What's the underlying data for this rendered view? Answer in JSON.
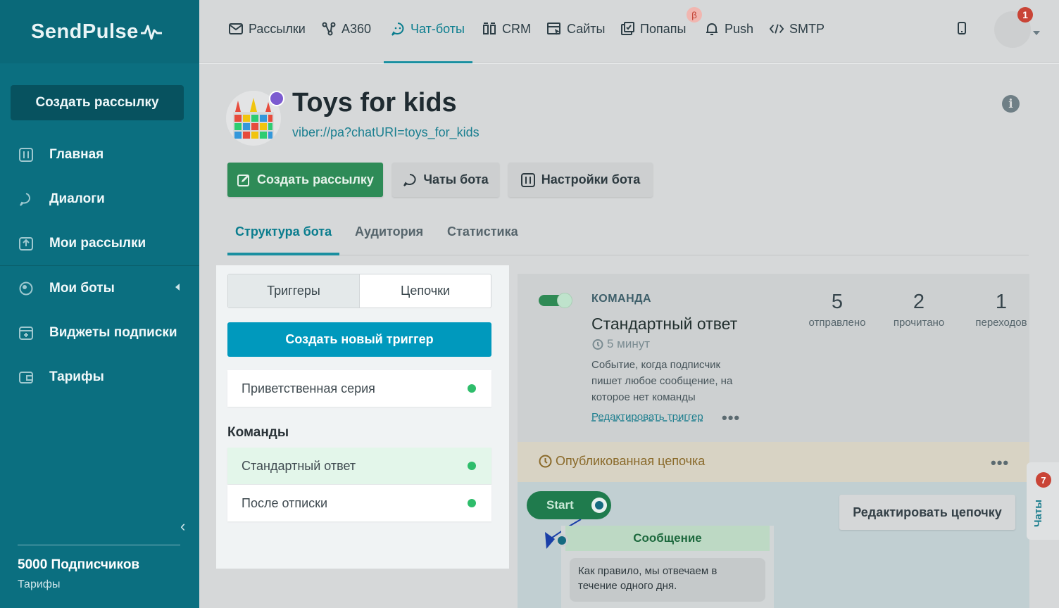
{
  "brand": {
    "logo_text": "SendPulse"
  },
  "sidebar": {
    "create_button": "Создать рассылку",
    "items": [
      {
        "label": "Главная",
        "icon": "dashboard-icon"
      },
      {
        "label": "Диалоги",
        "icon": "chat-bubble-icon"
      },
      {
        "label": "Мои рассылки",
        "icon": "upload-icon"
      },
      {
        "label": "Мои боты",
        "icon": "globe-icon"
      },
      {
        "label": "Виджеты подписки",
        "icon": "widget-icon"
      },
      {
        "label": "Тарифы",
        "icon": "wallet-icon"
      }
    ],
    "subscribers": "5000 Подписчиков",
    "tariffs_link": "Тарифы"
  },
  "topnav": {
    "items": [
      {
        "label": "Рассылки",
        "icon": "mail-icon"
      },
      {
        "label": "A360",
        "icon": "automation-icon"
      },
      {
        "label": "Чат-боты",
        "icon": "chatbot-icon",
        "active": true
      },
      {
        "label": "CRM",
        "icon": "crm-icon"
      },
      {
        "label": "Сайты",
        "icon": "site-icon"
      },
      {
        "label": "Попапы",
        "icon": "popup-icon"
      },
      {
        "label": "Push",
        "icon": "bell-icon"
      },
      {
        "label": "SMTP",
        "icon": "code-icon"
      }
    ],
    "beta_badge": "β",
    "notification_count": "1"
  },
  "bot": {
    "title": "Toys for kids",
    "url": "viber://pa?chatURI=toys_for_kids",
    "info": "i"
  },
  "actions": {
    "create_mailing": "Создать рассылку",
    "bot_chats": "Чаты бота",
    "bot_settings": "Настройки бота"
  },
  "tabs": [
    "Структура бота",
    "Аудитория",
    "Статистика"
  ],
  "panel": {
    "segments": [
      "Триггеры",
      "Цепочки"
    ],
    "create_trigger": "Создать новый триггер",
    "welcome": "Приветственная серия",
    "commands_title": "Команды",
    "commands": [
      "Стандартный ответ",
      "После отписки"
    ]
  },
  "detail": {
    "type_label": "КОМАНДА",
    "name": "Стандартный ответ",
    "delay": "5 минут",
    "description": "Событие, когда подписчик пишет любое сообщение, на которое нет команды",
    "edit_trigger": "Редактировать триггер",
    "stats": [
      {
        "value": "5",
        "label": "отправлено"
      },
      {
        "value": "2",
        "label": "прочитано"
      },
      {
        "value": "1",
        "label": "переходов"
      }
    ],
    "chain_status": "Опубликованная цепочка",
    "start": "Start",
    "edit_chain": "Редактировать цепочку",
    "message_title": "Сообщение",
    "message_text": "Как правило, мы отвечаем в течение одного дня."
  },
  "chats_tab": {
    "label": "Чаты",
    "count": "7"
  },
  "colors": {
    "sidebar": "#0b6f80",
    "accent": "#0a7d8e",
    "green": "#2e8b57",
    "blue": "#0099bd",
    "badge": "#c94436"
  }
}
